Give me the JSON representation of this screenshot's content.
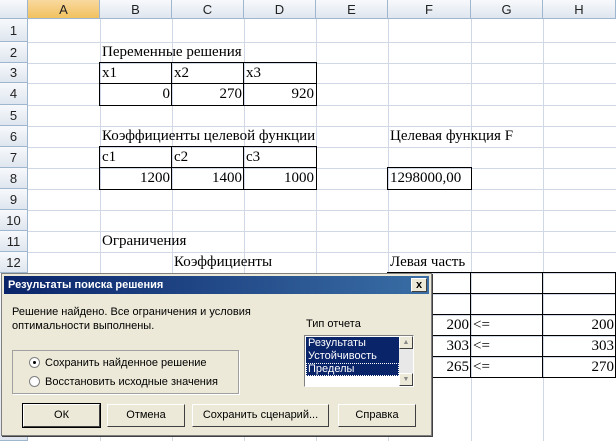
{
  "sheet": {
    "columns": [
      "A",
      "B",
      "C",
      "D",
      "E",
      "F",
      "G",
      "H"
    ],
    "rows": [
      "1",
      "2",
      "3",
      "4",
      "5",
      "6",
      "7",
      "8",
      "9",
      "10",
      "11",
      "12"
    ],
    "b2": "Переменные решения",
    "x_headers": [
      "x1",
      "x2",
      "x3"
    ],
    "x_values": [
      "0",
      "270",
      "920"
    ],
    "b6": "Коэффициенты целевой функции",
    "f6": "Целевая функция F",
    "c_headers": [
      "c1",
      "c2",
      "c3"
    ],
    "c_values": [
      "1200",
      "1400",
      "1000"
    ],
    "f8": "1298000,00",
    "b11": "Ограничения",
    "c12": "Коэффициенты",
    "f12": "Левая часть",
    "constraints": [
      {
        "lhs": "200",
        "op": "<=",
        "rhs": "200"
      },
      {
        "lhs": "303",
        "op": "<=",
        "rhs": "303"
      },
      {
        "lhs": "265",
        "op": "<=",
        "rhs": "270"
      }
    ]
  },
  "dialog": {
    "title": "Результаты поиска решения",
    "close": "x",
    "message_line1": "Решение найдено. Все ограничения и условия",
    "message_line2": "оптимальности выполнены.",
    "report_type_label": "Тип отчета",
    "reports": [
      "Результаты",
      "Устойчивость",
      "Пределы"
    ],
    "option_keep": "Сохранить найденное решение",
    "option_restore": "Восстановить исходные значения",
    "selected_option": "keep",
    "buttons": {
      "ok": "ОК",
      "cancel": "Отмена",
      "save_scenario": "Сохранить сценарий...",
      "help": "Справка"
    }
  }
}
